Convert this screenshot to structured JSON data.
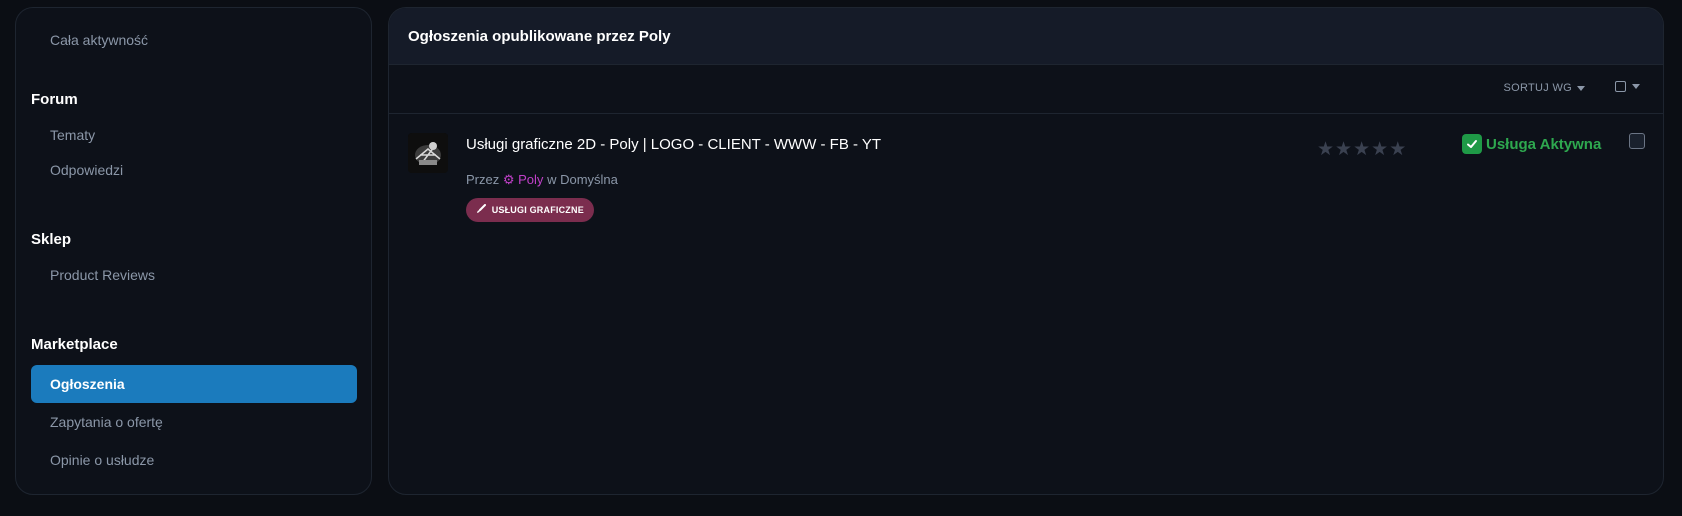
{
  "sidebar": {
    "top_items": [
      {
        "label": "Cała aktywność"
      }
    ],
    "sections": [
      {
        "heading": "Forum",
        "items": [
          {
            "label": "Tematy"
          },
          {
            "label": "Odpowiedzi"
          }
        ]
      },
      {
        "heading": "Sklep",
        "items": [
          {
            "label": "Product Reviews"
          }
        ]
      },
      {
        "heading": "Marketplace",
        "items": [
          {
            "label": "Ogłoszenia",
            "active": true
          },
          {
            "label": "Zapytania o ofertę"
          },
          {
            "label": "Opinie o usłudze"
          }
        ]
      }
    ]
  },
  "main": {
    "title": "Ogłoszenia opublikowane przez Poly",
    "sort_label": "SORTUJ WG",
    "listings": [
      {
        "title": "Usługi graficzne 2D - Poly | LOGO - CLIENT - WWW - FB - YT",
        "by_prefix": "Przez",
        "author": "Poly",
        "in_word": "w",
        "location": "Domyślna",
        "tag": "USŁUGI GRAFICZNE",
        "rating": 0,
        "rating_max": 5,
        "status": "Usługa Aktywna"
      }
    ]
  },
  "colors": {
    "accent": "#1b7bbd",
    "status_green": "#2ea84f",
    "tag_bg": "#7b2d4e",
    "author": "#c040c8"
  }
}
